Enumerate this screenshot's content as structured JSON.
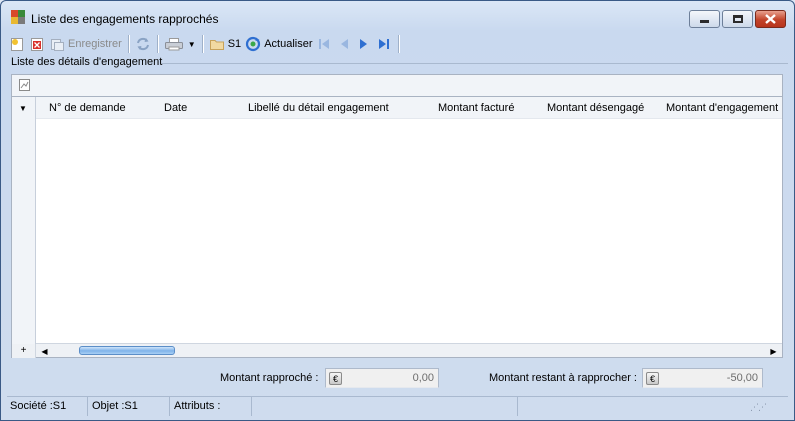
{
  "window": {
    "title": "Liste des engagements rapprochés",
    "controls": {
      "minimize": "minimize",
      "maximize": "maximize",
      "close": "close"
    }
  },
  "toolbar": {
    "new_icon": "new-document-icon",
    "delete_icon": "delete-icon",
    "save_label": "Enregistrer",
    "refresh_icon": "refresh-icon",
    "print_icon": "print-icon",
    "folder_label": "S1",
    "actualiser_label": "Actualiser",
    "nav_icons": [
      "first-record-icon",
      "previous-record-icon",
      "next-record-icon",
      "last-record-icon"
    ]
  },
  "group": {
    "title": "Liste des détails d'engagement"
  },
  "grid": {
    "columns": [
      "N° de demande",
      "Date",
      "Libellé du détail engagement",
      "Montant facturé",
      "Montant désengagé",
      "Montant d'engagement"
    ],
    "rows": []
  },
  "amounts": {
    "rapproche_label": "Montant rapproché :",
    "rapproche_value": "0,00",
    "restant_label": "Montant restant à rapprocher :",
    "restant_value": "-50,00",
    "currency_symbol": "€"
  },
  "statusbar": {
    "societe": "Société :S1",
    "objet": "Objet :S1",
    "attributs": "Attributs :"
  },
  "colors": {
    "window_bg": "#cfdcee",
    "accent_blue": "#2e6fd1",
    "close_red": "#c2442a"
  }
}
